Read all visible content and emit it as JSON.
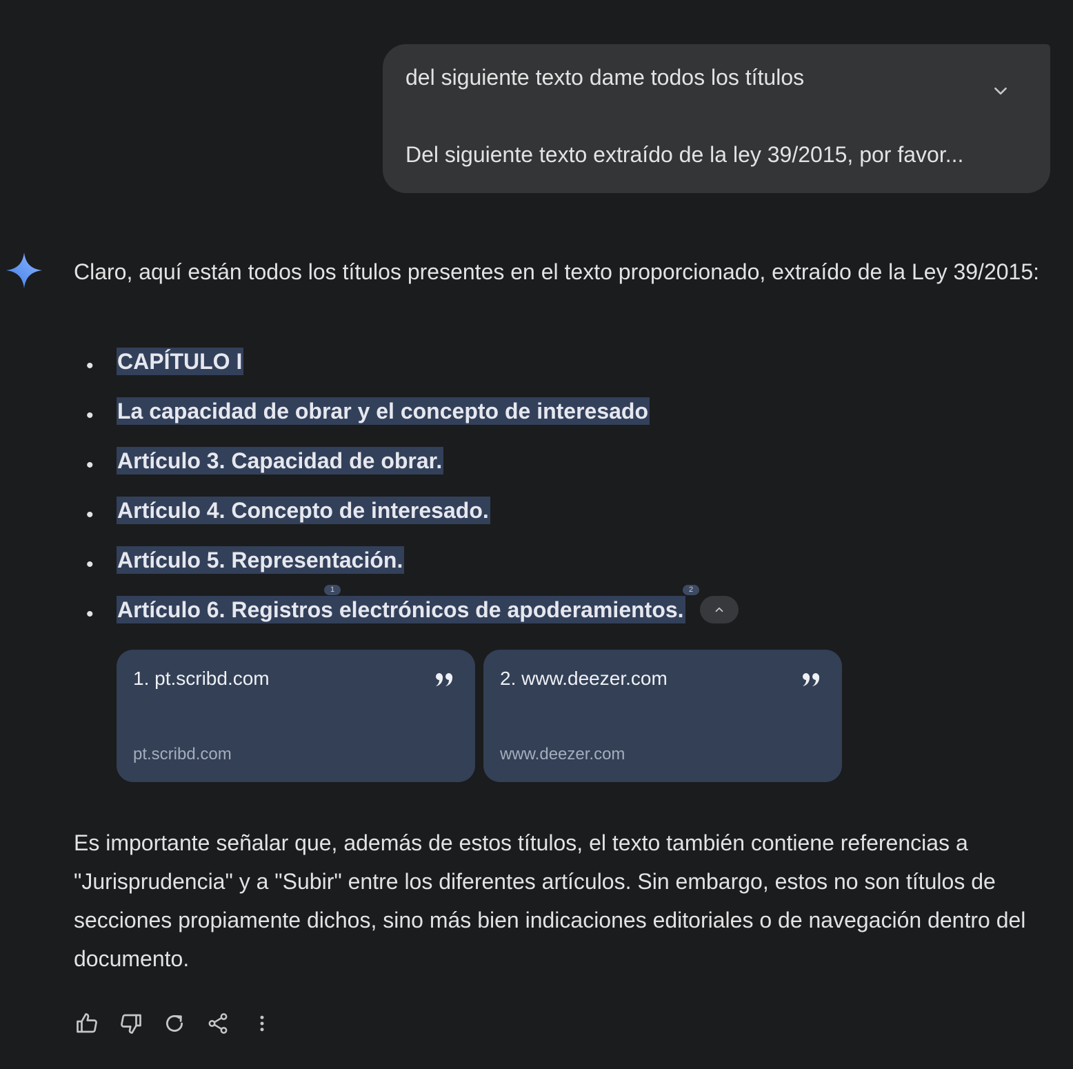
{
  "prompt": {
    "title": "del siguiente texto dame todos los títulos",
    "preview": "Del siguiente texto extraído de la ley 39/2015, por favor...",
    "expand_icon": "chevron-down-icon"
  },
  "response": {
    "avatar_icon": "gemini-sparkle-icon",
    "intro": "Claro, aquí están todos los títulos presentes en el texto proporcionado, extraído de la Ley 39/2015:",
    "bullet_glyph": "•",
    "titles": [
      "CAPÍTULO I",
      "La capacidad de obrar y el concepto de interesado",
      "Artículo 3. Capacidad de obrar.",
      "Artículo 4. Concepto de interesado.",
      "Artículo 5. Representación.",
      "Artículo 6. Registros electrónicos de apoderamientos."
    ],
    "citation_markers": [
      "1",
      "2"
    ],
    "collapse_icon": "chevron-up-icon",
    "sources": [
      {
        "title": "1. pt.scribd.com",
        "domain": "pt.scribd.com",
        "icon": "quote-icon"
      },
      {
        "title": "2. www.deezer.com",
        "domain": "www.deezer.com",
        "icon": "quote-icon"
      }
    ],
    "footnote": "Es importante señalar que, además de estos títulos, el texto también contiene referencias a \"Jurisprudencia\" y a \"Subir\" entre los diferentes artículos. Sin embargo, estos no son títulos de secciones propiamente dichos, sino más bien indicaciones editoriales o de navegación dentro del documento."
  },
  "actions": [
    "thumbs-up-icon",
    "thumbs-down-icon",
    "regenerate-icon",
    "share-icon",
    "more-vertical-icon"
  ],
  "colors": {
    "background": "#1b1c1e",
    "bubble": "#333537",
    "highlight": "#33405a",
    "card": "#334055",
    "text": "#e3e3e3",
    "sparkle_start": "#4c8df6",
    "sparkle_end": "#7aa7ff"
  }
}
